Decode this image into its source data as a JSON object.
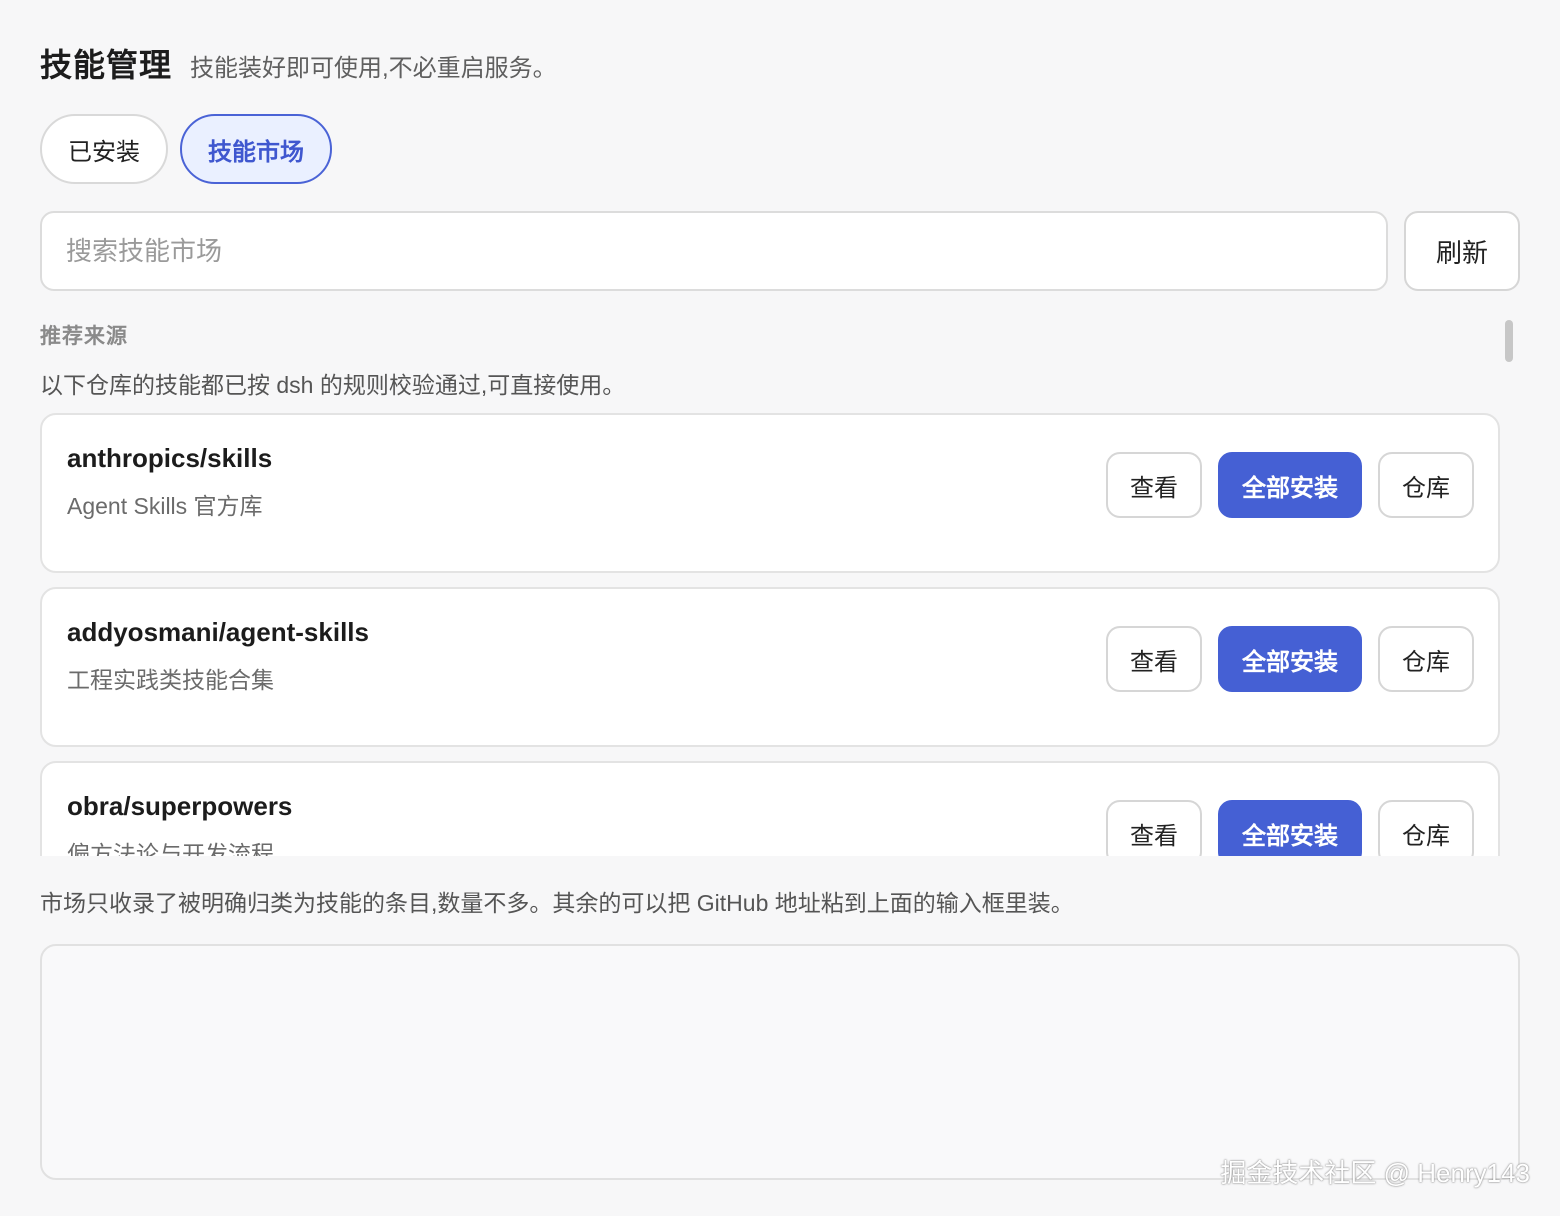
{
  "header": {
    "title": "技能管理",
    "subtitle": "技能装好即可使用,不必重启服务。"
  },
  "tabs": [
    {
      "label": "已安装",
      "active": false
    },
    {
      "label": "技能市场",
      "active": true
    }
  ],
  "search": {
    "placeholder": "搜索技能市场",
    "value": "",
    "refresh_label": "刷新"
  },
  "recommended": {
    "label": "推荐来源",
    "description": "以下仓库的技能都已按 dsh 的规则校验通过,可直接使用。"
  },
  "repos": [
    {
      "name": "anthropics/skills",
      "description": "Agent Skills 官方库",
      "view_label": "查看",
      "install_all_label": "全部安装",
      "repo_label": "仓库"
    },
    {
      "name": "addyosmani/agent-skills",
      "description": "工程实践类技能合集",
      "view_label": "查看",
      "install_all_label": "全部安装",
      "repo_label": "仓库"
    },
    {
      "name": "obra/superpowers",
      "description": "偏方法论与开发流程",
      "view_label": "查看",
      "install_all_label": "全部安装",
      "repo_label": "仓库"
    }
  ],
  "footer_note": "市场只收录了被明确归类为技能的条目,数量不多。其余的可以把 GitHub 地址粘到上面的输入框里装。",
  "watermark": "掘金技术社区 @ Henry143",
  "colors": {
    "accent": "#4560d4",
    "active_tab_bg": "#eaf0ff",
    "page_bg": "#f7f7f8"
  }
}
